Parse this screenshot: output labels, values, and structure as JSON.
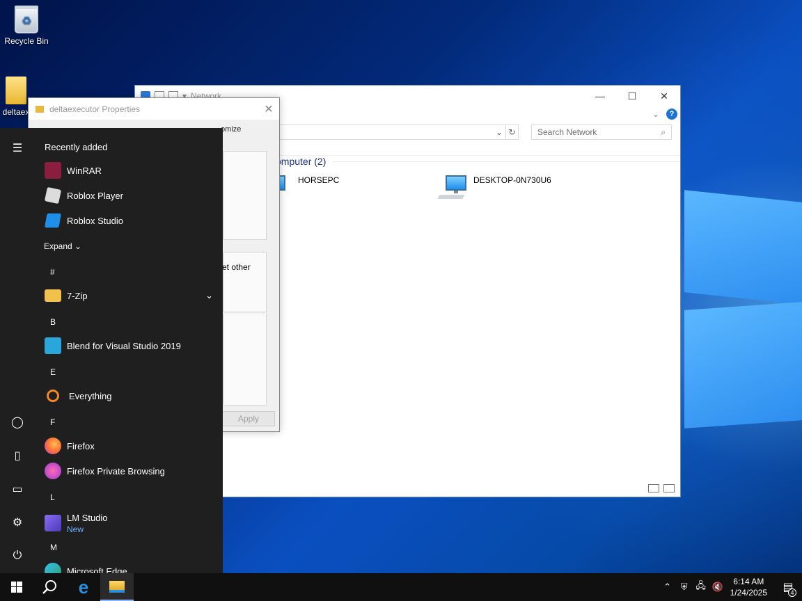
{
  "desktop": {
    "icons": [
      {
        "label": "Recycle Bin",
        "icon": "recycle-bin-icon"
      },
      {
        "label": "deltaex",
        "icon": "folder-icon"
      }
    ]
  },
  "explorer": {
    "title": "Network",
    "search_placeholder": "Search Network",
    "group_header": "omputer (2)",
    "computers": [
      "HORSEPC",
      "DESKTOP-0N730U6"
    ],
    "controls": {
      "minimize": "—",
      "maximize": "☐",
      "close": "✕"
    },
    "help": "?"
  },
  "properties_dialog": {
    "title": "deltaexecutor Properties",
    "tab_partial": "omize",
    "partial_text": "et other",
    "apply_label": "Apply",
    "close": "✕"
  },
  "start_menu": {
    "recently_added_title": "Recently added",
    "recent_apps": [
      {
        "label": "WinRAR",
        "icon": "winrar-icon",
        "color": "#8b1e3f"
      },
      {
        "label": "Roblox Player",
        "icon": "roblox-player-icon",
        "color": "#dcdcdc"
      },
      {
        "label": "Roblox Studio",
        "icon": "roblox-studio-icon",
        "color": "#1e8fe8"
      }
    ],
    "expand_label": "Expand",
    "sections": [
      {
        "letter": "#",
        "apps": [
          {
            "label": "7-Zip",
            "icon": "folder-icon",
            "color": "#f2c04c",
            "expandable": true
          }
        ]
      },
      {
        "letter": "B",
        "apps": [
          {
            "label": "Blend for Visual Studio 2019",
            "icon": "blend-icon",
            "color": "#2aa6d8"
          }
        ]
      },
      {
        "letter": "E",
        "apps": [
          {
            "label": "Everything",
            "icon": "magnifier-icon",
            "color": "#f08a24"
          }
        ]
      },
      {
        "letter": "F",
        "apps": [
          {
            "label": "Firefox",
            "icon": "firefox-icon",
            "color": "#ff7139"
          },
          {
            "label": "Firefox Private Browsing",
            "icon": "firefox-private-icon",
            "color": "#9b3bd6"
          }
        ]
      },
      {
        "letter": "L",
        "apps": [
          {
            "label": "LM Studio",
            "icon": "lm-studio-icon",
            "color": "#6b4fd8",
            "badge": "New"
          }
        ]
      },
      {
        "letter": "M",
        "apps": [
          {
            "label": "Microsoft Edge",
            "icon": "edge-icon",
            "color": "#2f9c6e"
          }
        ]
      }
    ],
    "rail_icons": [
      "hamburger-icon",
      "user-icon",
      "document-icon",
      "pictures-icon",
      "settings-icon",
      "power-icon"
    ]
  },
  "taskbar": {
    "time": "6:14 AM",
    "date": "1/24/2025",
    "notification_count": "4"
  }
}
